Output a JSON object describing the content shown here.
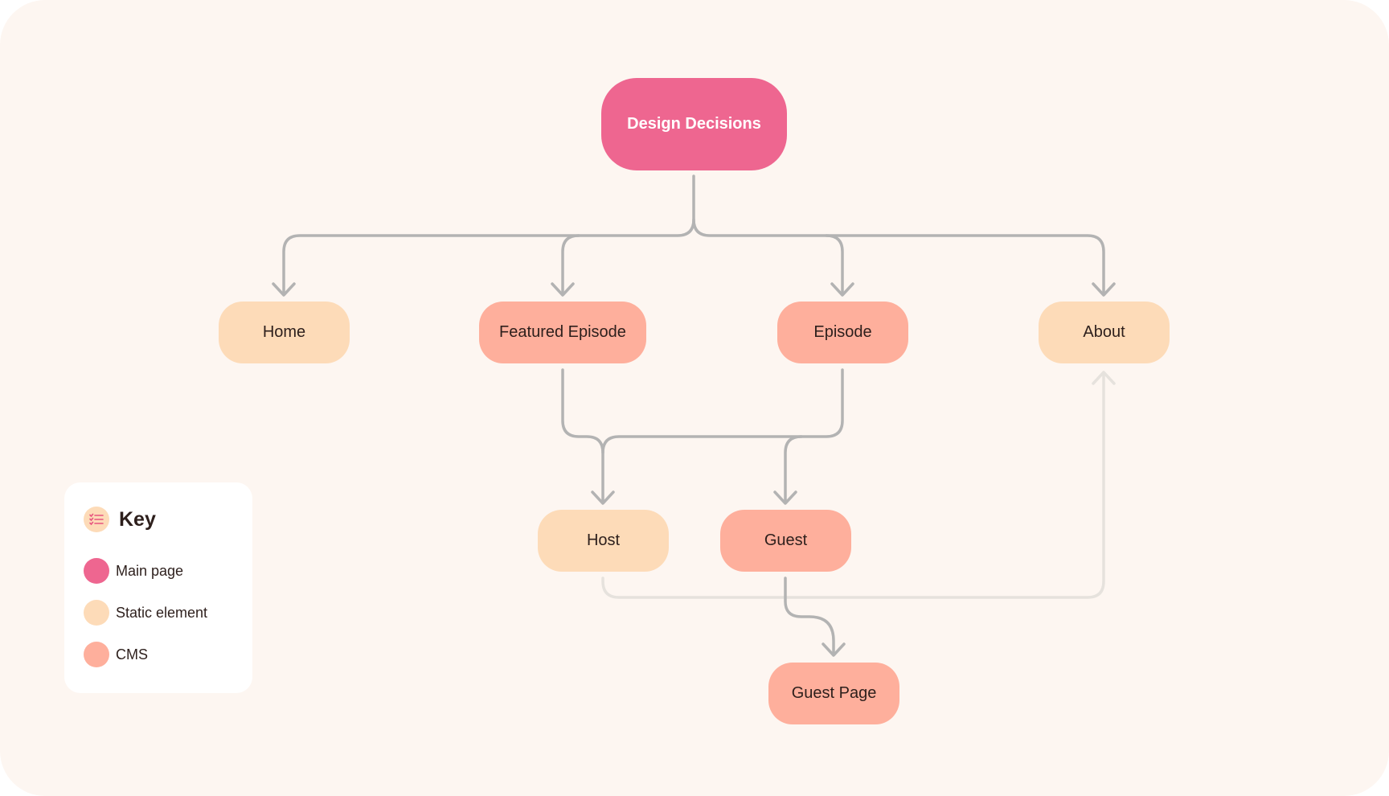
{
  "diagram": {
    "title": "Design Decisions",
    "colors": {
      "main_page": "#ee6690",
      "static_element": "#fddbb8",
      "cms": "#feaf9c",
      "connector": "#b3b3b3",
      "connector_faded": "#e6e2dd",
      "background": "#fdf6f1"
    },
    "nodes": {
      "root": {
        "label": "Design Decisions",
        "type": "Main page"
      },
      "home": {
        "label": "Home",
        "type": "Static element"
      },
      "featured_episode": {
        "label": "Featured Episode",
        "type": "CMS"
      },
      "episode": {
        "label": "Episode",
        "type": "CMS"
      },
      "about": {
        "label": "About",
        "type": "Static element"
      },
      "host": {
        "label": "Host",
        "type": "Static element"
      },
      "guest": {
        "label": "Guest",
        "type": "CMS"
      },
      "guest_page": {
        "label": "Guest Page",
        "type": "CMS"
      }
    },
    "edges": [
      {
        "from": "Design Decisions",
        "to": "Home"
      },
      {
        "from": "Design Decisions",
        "to": "Featured Episode"
      },
      {
        "from": "Design Decisions",
        "to": "Episode"
      },
      {
        "from": "Design Decisions",
        "to": "About"
      },
      {
        "from": "Featured Episode",
        "to": "Host"
      },
      {
        "from": "Featured Episode",
        "to": "Guest"
      },
      {
        "from": "Episode",
        "to": "Host"
      },
      {
        "from": "Episode",
        "to": "Guest"
      },
      {
        "from": "Guest",
        "to": "Guest Page"
      },
      {
        "from": "Host",
        "to": "About",
        "style": "faded"
      }
    ]
  },
  "key": {
    "title": "Key",
    "icon": "checklist-icon",
    "items": [
      {
        "label": "Main page",
        "color": "#ee6690"
      },
      {
        "label": "Static element",
        "color": "#fddbb8"
      },
      {
        "label": "CMS",
        "color": "#feaf9c"
      }
    ]
  }
}
